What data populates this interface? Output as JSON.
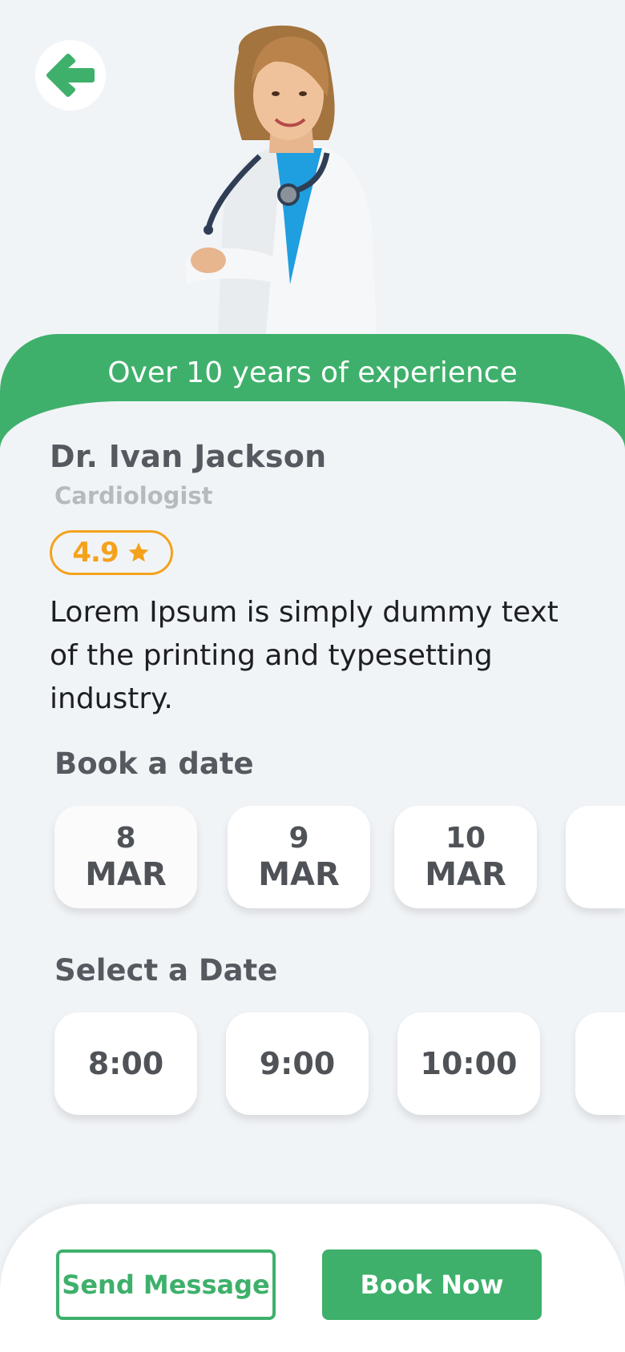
{
  "header": {
    "back_icon": "arrow-left-icon",
    "photo": "doctor-portrait-photo"
  },
  "experience_text": "Over 10 years of experience",
  "doctor": {
    "name": "Dr. Ivan Jackson",
    "specialty": "Cardiologist",
    "rating": "4.9",
    "rating_icon": "star-icon",
    "bio": "Lorem Ipsum is simply dummy text of the printing and typesetting industry."
  },
  "book_date": {
    "title": "Book a date",
    "dates": [
      {
        "day": "8",
        "month": "MAR"
      },
      {
        "day": "9",
        "month": "MAR"
      },
      {
        "day": "10",
        "month": "MAR"
      }
    ]
  },
  "select_time": {
    "title": "Select a Date",
    "times": [
      "8:00",
      "9:00",
      "10:00"
    ]
  },
  "actions": {
    "send_message": "Send Message",
    "book_now": "Book Now"
  },
  "colors": {
    "accent": "#3eb06b",
    "rating": "#f4a21c",
    "background": "#f1f4f7"
  }
}
